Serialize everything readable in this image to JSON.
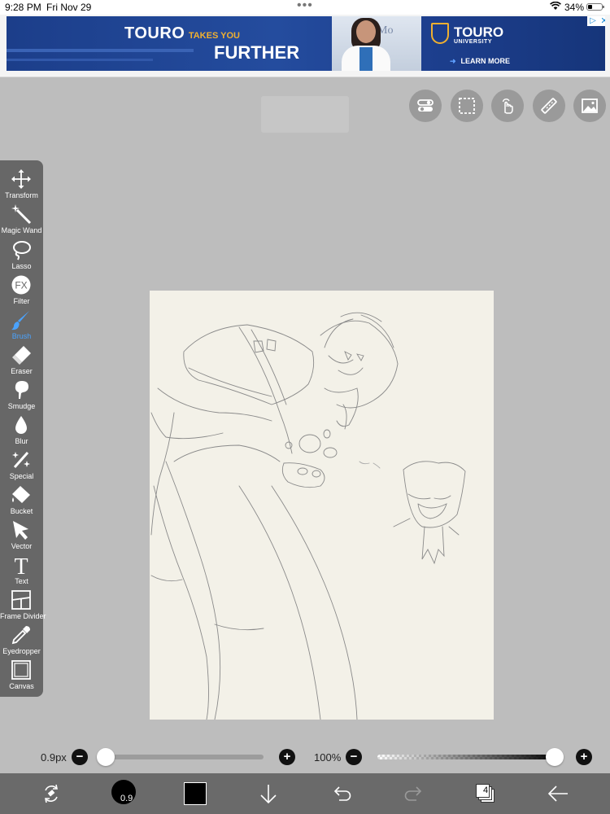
{
  "status_bar": {
    "time": "9:28 PM",
    "date": "Fri Nov 29",
    "dots": "•••",
    "battery_pct": "34%",
    "battery_level": 0.34
  },
  "ad": {
    "headline_brand": "TOURO",
    "headline_small": "TAKES YOU",
    "headline_line2": "FURTHER",
    "logo_name": "TOURO",
    "logo_sub": "UNIVERSITY",
    "cta": "LEARN MORE",
    "photo_sign": "Mo",
    "choice_icon": "ad-choices-icon",
    "close_glyph": "✕"
  },
  "top_buttons": [
    {
      "name": "toggle-settings-button",
      "icon": "toggle-icon"
    },
    {
      "name": "selection-button",
      "icon": "dashed-square-icon"
    },
    {
      "name": "gesture-button",
      "icon": "hand-touch-icon"
    },
    {
      "name": "ruler-button",
      "icon": "ruler-icon"
    },
    {
      "name": "image-button",
      "icon": "image-icon"
    }
  ],
  "tools": [
    {
      "label": "Transform",
      "icon": "move-arrows-icon",
      "active": false
    },
    {
      "label": "Magic Wand",
      "icon": "magic-wand-icon",
      "active": false
    },
    {
      "label": "Lasso",
      "icon": "lasso-icon",
      "active": false
    },
    {
      "label": "Filter",
      "icon": "fx-icon",
      "active": false
    },
    {
      "label": "Brush",
      "icon": "brush-icon",
      "active": true
    },
    {
      "label": "Eraser",
      "icon": "eraser-icon",
      "active": false
    },
    {
      "label": "Smudge",
      "icon": "smudge-icon",
      "active": false
    },
    {
      "label": "Blur",
      "icon": "drop-icon",
      "active": false
    },
    {
      "label": "Special",
      "icon": "special-wand-icon",
      "active": false
    },
    {
      "label": "Bucket",
      "icon": "bucket-icon",
      "active": false
    },
    {
      "label": "Vector",
      "icon": "cursor-arrow-icon",
      "active": false
    },
    {
      "label": "Text",
      "icon": "text-t-icon",
      "active": false
    },
    {
      "label": "Frame Divider",
      "icon": "frame-divider-icon",
      "active": false
    },
    {
      "label": "Eyedropper",
      "icon": "eyedropper-icon",
      "active": false
    },
    {
      "label": "Canvas",
      "icon": "canvas-icon",
      "active": false
    }
  ],
  "sliders": {
    "brush_size": "0.9px",
    "brush_size_level": 0.0,
    "opacity": "100%",
    "opacity_level": 1.0,
    "minus_glyph": "−",
    "plus_glyph": "+"
  },
  "bottom_bar": {
    "brush_preview_label": "0.9",
    "layer_count": "4",
    "items": [
      "swap-icon",
      "brush-preview",
      "color-swatch",
      "import-down-arrow-icon",
      "undo-icon",
      "redo-icon",
      "layers-icon",
      "back-arrow-icon"
    ]
  },
  "colors": {
    "background": "#bdbdbd",
    "panel": "#676767",
    "active_tool": "#4aa3ff",
    "canvas": "#f3f1e8",
    "ad_blue": "#1c3e8a",
    "ad_gold": "#f0b030"
  }
}
